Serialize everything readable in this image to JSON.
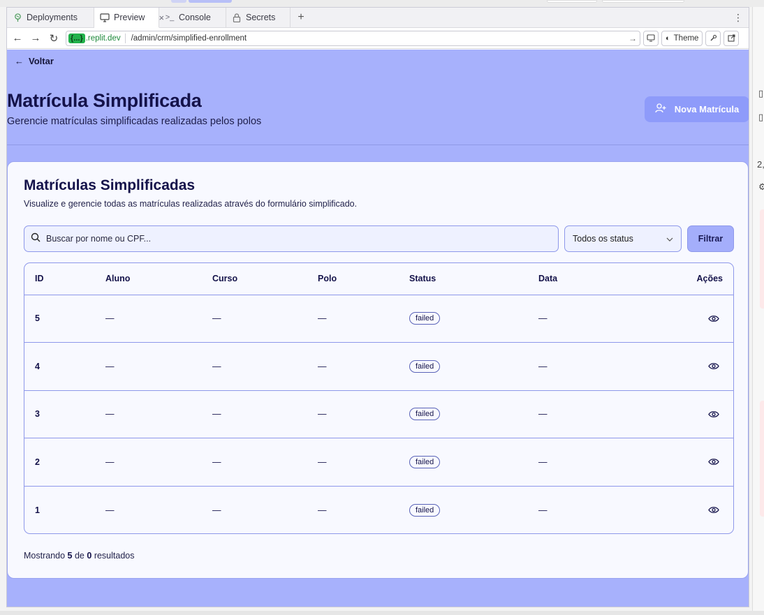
{
  "browser": {
    "tabs": [
      {
        "label": "Deployments",
        "icon": "deployments-icon"
      },
      {
        "label": "Preview",
        "icon": "monitor-icon",
        "active": true
      },
      {
        "label": "Console",
        "icon": "terminal-icon"
      },
      {
        "label": "Secrets",
        "icon": "lock-icon"
      }
    ],
    "url": {
      "subdomain": "{...}",
      "domain": ".replit.dev",
      "path": "/admin/crm/simplified-enrollment"
    },
    "theme_label": "Theme"
  },
  "page": {
    "back_label": "Voltar",
    "title": "Matrícula Simplificada",
    "subtitle": "Gerencie matrículas simplificadas realizadas pelos polos",
    "new_button": "Nova Matrícula"
  },
  "card": {
    "title": "Matrículas Simplificadas",
    "subtitle": "Visualize e gerencie todas as matrículas realizadas através do formulário simplificado.",
    "search_placeholder": "Buscar por nome ou CPF...",
    "status_select": "Todos os status",
    "filter_button": "Filtrar",
    "columns": [
      "ID",
      "Aluno",
      "Curso",
      "Polo",
      "Status",
      "Data",
      "Ações"
    ],
    "rows": [
      {
        "id": "5",
        "aluno": "—",
        "curso": "—",
        "polo": "—",
        "status": "failed",
        "data": "—"
      },
      {
        "id": "4",
        "aluno": "—",
        "curso": "—",
        "polo": "—",
        "status": "failed",
        "data": "—"
      },
      {
        "id": "3",
        "aluno": "—",
        "curso": "—",
        "polo": "—",
        "status": "failed",
        "data": "—"
      },
      {
        "id": "2",
        "aluno": "—",
        "curso": "—",
        "polo": "—",
        "status": "failed",
        "data": "—"
      },
      {
        "id": "1",
        "aluno": "—",
        "curso": "—",
        "polo": "—",
        "status": "failed",
        "data": "—"
      }
    ],
    "footer": {
      "prefix": "Mostrando",
      "shown": "5",
      "mid": "de",
      "total": "0",
      "suffix": "resultados"
    }
  },
  "side_fragments": [
    "2,"
  ],
  "colors": {
    "page_bg": "#a7b1fc",
    "accent": "#8e9bfa",
    "card_bg": "#f8f9ff",
    "text_dark": "#14124a"
  }
}
